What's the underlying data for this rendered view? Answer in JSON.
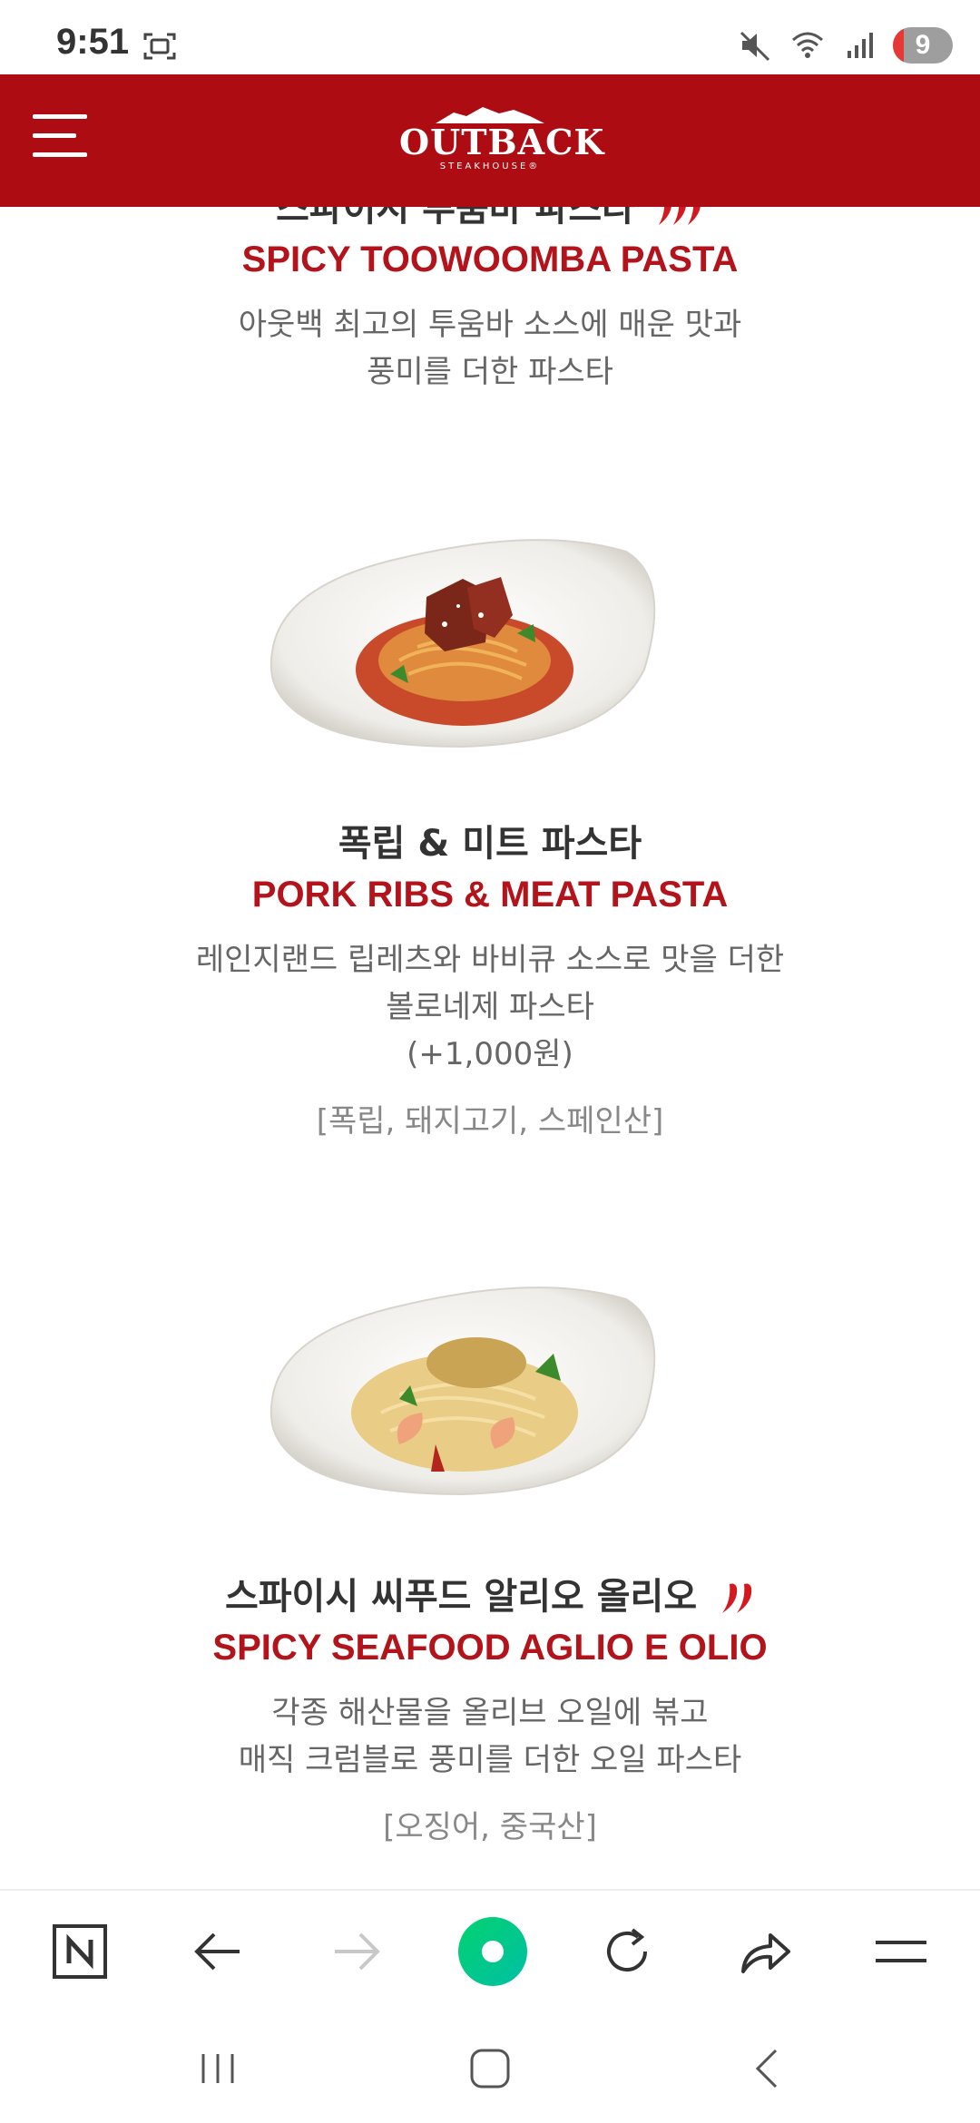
{
  "status": {
    "time": "9:51",
    "battery_level": "9",
    "icons": [
      "screenshot-icon",
      "mute-icon",
      "wifi-icon",
      "signal-icon"
    ]
  },
  "header": {
    "logo_main": "OUTBACK",
    "logo_sub": "STEAKHOUSE®",
    "menu_icon": "hamburger-menu-icon",
    "brand_color": "#ad0c12"
  },
  "menu": {
    "item1": {
      "ko_title": "스파이시 투움바 파스타",
      "en_title": "SPICY TOOWOOMBA PASTA",
      "desc_line1": "아웃백 최고의 투움바 소스에 매운 맛과",
      "desc_line2": "풍미를 더한 파스타"
    },
    "item2": {
      "ko_title": "폭립 & 미트 파스타",
      "en_title": "PORK RIBS & MEAT PASTA",
      "desc_line1": "레인지랜드 립레츠와 바비큐 소스로 맛을 더한",
      "desc_line2": "볼로네제 파스타",
      "price_note": "(+1,000원)",
      "origin": "[폭립, 돼지고기, 스페인산]"
    },
    "item3": {
      "ko_title": "스파이시 씨푸드 알리오 올리오",
      "en_title": "SPICY SEAFOOD AGLIO E OLIO",
      "desc_line1": "각종 해산물을 올리브 오일에 볶고",
      "desc_line2": "매직 크럼블로 풍미를 더한 오일 파스타",
      "origin": "[오징어, 중국산]"
    }
  },
  "toolbar": {
    "buttons": [
      "naver-home-icon",
      "back-arrow-icon",
      "forward-arrow-icon",
      "green-dot-icon",
      "refresh-icon",
      "share-icon",
      "menu-lines-icon"
    ],
    "accent_green": "#03c75a"
  },
  "navbar": {
    "buttons": [
      "recent-apps-icon",
      "home-icon",
      "back-icon"
    ]
  }
}
